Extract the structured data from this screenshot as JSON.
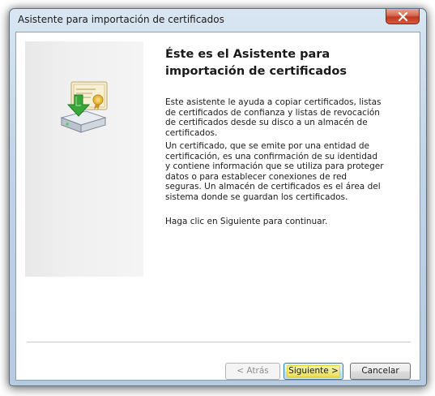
{
  "window": {
    "title": "Asistente para importación de certificados"
  },
  "content": {
    "heading": "Éste es el Asistente para importación de certificados",
    "paragraph1": "Este asistente le ayuda a copiar certificados, listas de certificados de confianza y listas de revocación de certificados desde su disco a un almacén de certificados.",
    "paragraph2": "Un certificado, que se emite por una entidad de certificación, es una confirmación de su identidad y contiene información que se utiliza para proteger datos o para establecer conexiones de red seguras. Un almacén de certificados es el área del sistema donde se guardan los certificados.",
    "paragraph3": "Haga clic en Siguiente para continuar."
  },
  "buttons": {
    "back": "< Atrás",
    "next": "Siguiente >",
    "cancel": "Cancelar"
  },
  "icons": {
    "close": "close-icon",
    "wizard_graphic": "certificate-import-icon"
  }
}
